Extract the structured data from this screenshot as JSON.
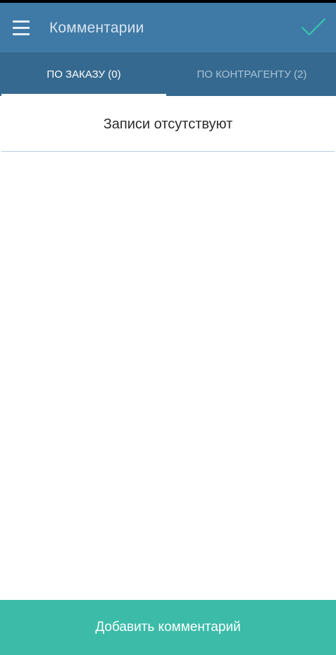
{
  "header": {
    "title": "Комментарии",
    "menu_icon": "hamburger-menu-icon",
    "confirm_icon": "checkmark-icon"
  },
  "tabs": [
    {
      "label": "ПО ЗАКАЗУ (0)",
      "selected": true
    },
    {
      "label": "ПО КОНТРАГЕНТУ (2)",
      "selected": false
    }
  ],
  "content": {
    "empty_message": "Записи отсутствуют"
  },
  "footer": {
    "add_label": "Добавить комментарий"
  },
  "colors": {
    "app_bar": "#3f7aa6",
    "tab_bar": "#36698f",
    "accent": "#3bbba8",
    "check": "#3bc4ad"
  }
}
